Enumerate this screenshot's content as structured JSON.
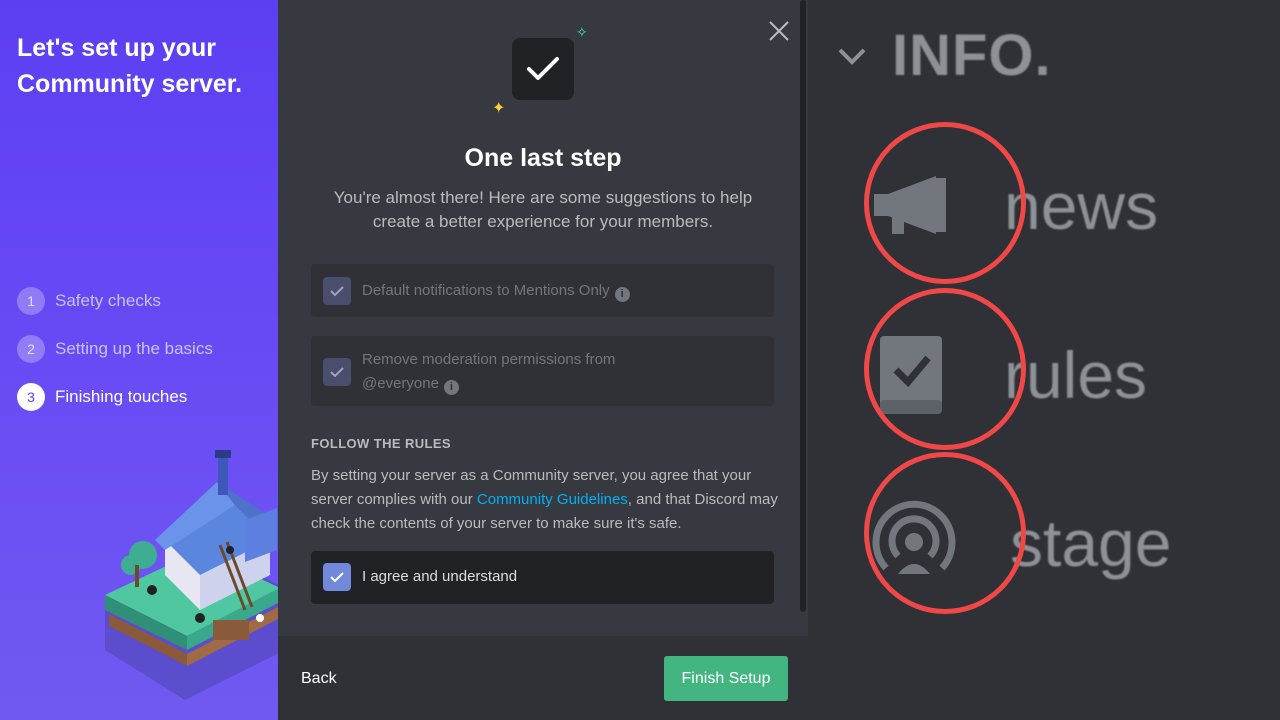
{
  "left_panel": {
    "title": "Let's set up your Community server.",
    "steps": [
      {
        "number": "1",
        "label": "Safety checks",
        "state": "done"
      },
      {
        "number": "2",
        "label": "Setting up the basics",
        "state": "done"
      },
      {
        "number": "3",
        "label": "Finishing touches",
        "state": "active"
      }
    ]
  },
  "modal": {
    "title": "One last step",
    "subtitle": "You're almost there! Here are some suggestions to help create a better experience for your members.",
    "options": [
      {
        "label": "Default notifications to Mentions Only",
        "info_icon": "info-icon",
        "checked": true,
        "disabled": true
      },
      {
        "label_line1": "Remove moderation permissions from",
        "label_line2": "@everyone",
        "info_icon": "info-icon",
        "checked": true,
        "disabled": true
      }
    ],
    "rules_header": "FOLLOW THE RULES",
    "rules_text_before": "By setting your server as a Community server, you agree that your server complies with our ",
    "rules_link": "Community Guidelines",
    "rules_text_after": ", and that Discord may check the contents of your server to make sure it's safe.",
    "agree_label": "I agree and understand",
    "agree_checked": true,
    "footer": {
      "back_label": "Back",
      "finish_label": "Finish Setup"
    }
  },
  "zoom_panel": {
    "category": "INFO.",
    "channels": [
      {
        "name": "news",
        "icon": "megaphone-icon"
      },
      {
        "name": "rules",
        "icon": "rules-book-icon"
      },
      {
        "name": "stage",
        "icon": "stage-broadcast-icon"
      }
    ]
  },
  "colors": {
    "accent_purple": "#5c3ff2",
    "blurple": "#7289da",
    "green": "#43b581",
    "link": "#00b0f4",
    "highlight_ring": "#f04747"
  }
}
